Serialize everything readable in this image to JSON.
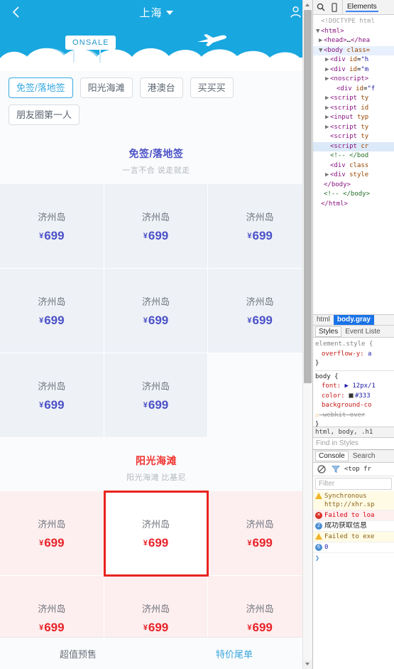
{
  "phone": {
    "navbar": {
      "back_icon": "chevron-left-icon",
      "title": "上海",
      "caret_icon": "caret-down-icon",
      "user_icon": "person-icon"
    },
    "hero": {
      "onsale_label": "ONSALE",
      "plane_icon": "airplane-icon",
      "bg_color": "#19a7e0",
      "cloud_color": "#ffffff"
    },
    "chips": [
      {
        "label": "免签/落地签",
        "active": true
      },
      {
        "label": "阳光海滩",
        "active": false
      },
      {
        "label": "港澳台",
        "active": false
      },
      {
        "label": "买买买",
        "active": false
      },
      {
        "label": "朋友圈第一人",
        "active": false
      }
    ],
    "sections": [
      {
        "title": "免签/落地签",
        "subtitle": "一言不合 说走就走",
        "title_color": "#4b51c7",
        "price_color": "#4b51c7",
        "card_bg": "#eef1f6",
        "cards": [
          {
            "name": "济州岛",
            "currency": "¥",
            "price": "699",
            "selected": false
          },
          {
            "name": "济州岛",
            "currency": "¥",
            "price": "699",
            "selected": false
          },
          {
            "name": "济州岛",
            "currency": "¥",
            "price": "699",
            "selected": false
          },
          {
            "name": "济州岛",
            "currency": "¥",
            "price": "699",
            "selected": false
          },
          {
            "name": "济州岛",
            "currency": "¥",
            "price": "699",
            "selected": false
          },
          {
            "name": "济州岛",
            "currency": "¥",
            "price": "699",
            "selected": false
          },
          {
            "name": "济州岛",
            "currency": "¥",
            "price": "699",
            "selected": false
          },
          {
            "name": "济州岛",
            "currency": "¥",
            "price": "699",
            "selected": false
          }
        ]
      },
      {
        "title": "阳光海滩",
        "subtitle": "阳光海滩 比基尼",
        "title_color": "#f0332f",
        "price_color": "#e8232a",
        "card_bg": "#fdeeef",
        "selection_outline_color": "#e8231f",
        "cards": [
          {
            "name": "济州岛",
            "currency": "¥",
            "price": "699",
            "selected": false
          },
          {
            "name": "济州岛",
            "currency": "¥",
            "price": "699",
            "selected": true
          },
          {
            "name": "济州岛",
            "currency": "¥",
            "price": "699",
            "selected": false
          },
          {
            "name": "济州岛",
            "currency": "¥",
            "price": "699",
            "selected": false
          },
          {
            "name": "济州岛",
            "currency": "¥",
            "price": "699",
            "selected": false
          },
          {
            "name": "济州岛",
            "currency": "¥",
            "price": "699",
            "selected": false
          }
        ]
      }
    ],
    "bottom_tabs": [
      {
        "label": "超值预售",
        "active": false
      },
      {
        "label": "特价尾单",
        "active": true
      }
    ]
  },
  "devtools": {
    "toolbar": {
      "search_icon": "search-icon",
      "device_icon": "device-toggle-icon",
      "tabs": [
        {
          "label": "Elements",
          "active": true
        }
      ]
    },
    "dom": [
      {
        "indent": 0,
        "twisty": "",
        "html": "<span class=\"doctype\">&lt;!DOCTYPE html</span>",
        "state": ""
      },
      {
        "indent": 0,
        "twisty": "▼",
        "html": "<span class=\"tag\">&lt;html&gt;</span>",
        "state": ""
      },
      {
        "indent": 1,
        "twisty": "▶",
        "html": "<span class=\"tag\">&lt;head&gt;</span>…<span class=\"tag\">&lt;/hea</span>",
        "state": ""
      },
      {
        "indent": 1,
        "twisty": "▼",
        "html": "<span class=\"tag\">&lt;body</span> <span class=\"attr\">class=</span>",
        "state": "hl"
      },
      {
        "indent": 2,
        "twisty": "▶",
        "html": "<span class=\"tag\">&lt;div</span> <span class=\"attr\">id</span>=<span class=\"val\">\"h</span>",
        "state": ""
      },
      {
        "indent": 2,
        "twisty": "▶",
        "html": "<span class=\"tag\">&lt;div</span> <span class=\"attr\">id</span>=<span class=\"val\">\"m</span>",
        "state": ""
      },
      {
        "indent": 2,
        "twisty": "▶",
        "html": "<span class=\"tag\">&lt;noscript&gt;</span>",
        "state": ""
      },
      {
        "indent": 3,
        "twisty": "",
        "html": "<span class=\"tag\">&lt;div</span> <span class=\"attr\">id</span>=<span class=\"val\">\"f</span>",
        "state": ""
      },
      {
        "indent": 2,
        "twisty": "▶",
        "html": "<span class=\"tag\">&lt;script</span> <span class=\"attr\">ty</span>",
        "state": ""
      },
      {
        "indent": 2,
        "twisty": "▶",
        "html": "<span class=\"tag\">&lt;script</span> <span class=\"attr\">id</span>",
        "state": ""
      },
      {
        "indent": 2,
        "twisty": "▶",
        "html": "<span class=\"tag\">&lt;input</span> <span class=\"attr\">typ</span>",
        "state": ""
      },
      {
        "indent": 2,
        "twisty": "▶",
        "html": "<span class=\"tag\">&lt;script</span> <span class=\"attr\">ty</span>",
        "state": ""
      },
      {
        "indent": 2,
        "twisty": "",
        "html": "<span class=\"tag\">&lt;script</span> <span class=\"attr\">ty</span>",
        "state": ""
      },
      {
        "indent": 2,
        "twisty": "",
        "html": "<span class=\"tag\">&lt;script</span> <span class=\"attr\">cr</span>",
        "state": "sel"
      },
      {
        "indent": 2,
        "twisty": "",
        "html": "<span class=\"cmt\">&lt;!-- &lt;/bod</span>",
        "state": ""
      },
      {
        "indent": 2,
        "twisty": "",
        "html": "<span class=\"tag\">&lt;div</span> <span class=\"attr\">class</span>",
        "state": ""
      },
      {
        "indent": 2,
        "twisty": "▶",
        "html": "<span class=\"tag\">&lt;div</span> <span class=\"attr\">style</span>",
        "state": ""
      },
      {
        "indent": 1,
        "twisty": "",
        "html": "<span class=\"tag\">&lt;/body&gt;</span>",
        "state": ""
      },
      {
        "indent": 1,
        "twisty": "",
        "html": "<span class=\"cmt\">&lt;!-- &lt;/body&gt;</span>",
        "state": ""
      },
      {
        "indent": 0,
        "twisty": "",
        "html": "<span class=\"tag\">&lt;/html&gt;</span>",
        "state": ""
      }
    ],
    "breadcrumbs": [
      {
        "label": "html",
        "active": false
      },
      {
        "label": "body.gray",
        "active": true
      }
    ],
    "side_tabs": [
      {
        "label": "Styles",
        "active": true
      },
      {
        "label": "Event Liste",
        "active": false
      }
    ],
    "styles": {
      "rule1_selector": "element.style {",
      "rule1_prop": "overflow-y:",
      "rule1_val": "a",
      "rule1_close": "}",
      "rule2_selector": "body {",
      "rule2_lines": [
        {
          "prop": "font:",
          "val": "▶ 12px/1",
          "kind": "plain"
        },
        {
          "prop": "color:",
          "val": "#333",
          "kind": "swatch"
        },
        {
          "prop": "background-co",
          "val": "",
          "kind": "plain"
        },
        {
          "prop": "-webkit-over",
          "val": "",
          "kind": "strike"
        }
      ],
      "rule2_close": "}",
      "computed_selector": "html, body, .h1",
      "find_placeholder": "Find in Styles"
    },
    "drawer_tabs": [
      {
        "label": "Console",
        "active": true
      },
      {
        "label": "Search",
        "active": false
      }
    ],
    "console": {
      "clear_icon": "clear-console-icon",
      "filter_icon": "funnel-icon",
      "context": "<top fr",
      "filter_placeholder": "Filter",
      "logs": [
        {
          "level": "warn",
          "badge": "warning-triangle-icon",
          "text": "Synchronous ",
          "sub": "http://xhr.sp"
        },
        {
          "level": "err",
          "badge": "error-circle-icon",
          "count": "",
          "text": "Failed to loa",
          "sub": ""
        },
        {
          "level": "info",
          "badge": "info-circle-icon",
          "count": "2",
          "text": "成功获取信息",
          "sub": ""
        },
        {
          "level": "warn",
          "badge": "warning-triangle-icon",
          "text": "Failed to exe",
          "sub": ""
        },
        {
          "level": "info",
          "badge": "info-circle-icon",
          "count": "6",
          "text": "0",
          "sub": ""
        }
      ],
      "prompt": "❯"
    }
  },
  "scrollbar": {
    "up_arrow_icon": "scroll-up-arrow-icon",
    "down_arrow_icon": "scroll-down-arrow-icon"
  }
}
